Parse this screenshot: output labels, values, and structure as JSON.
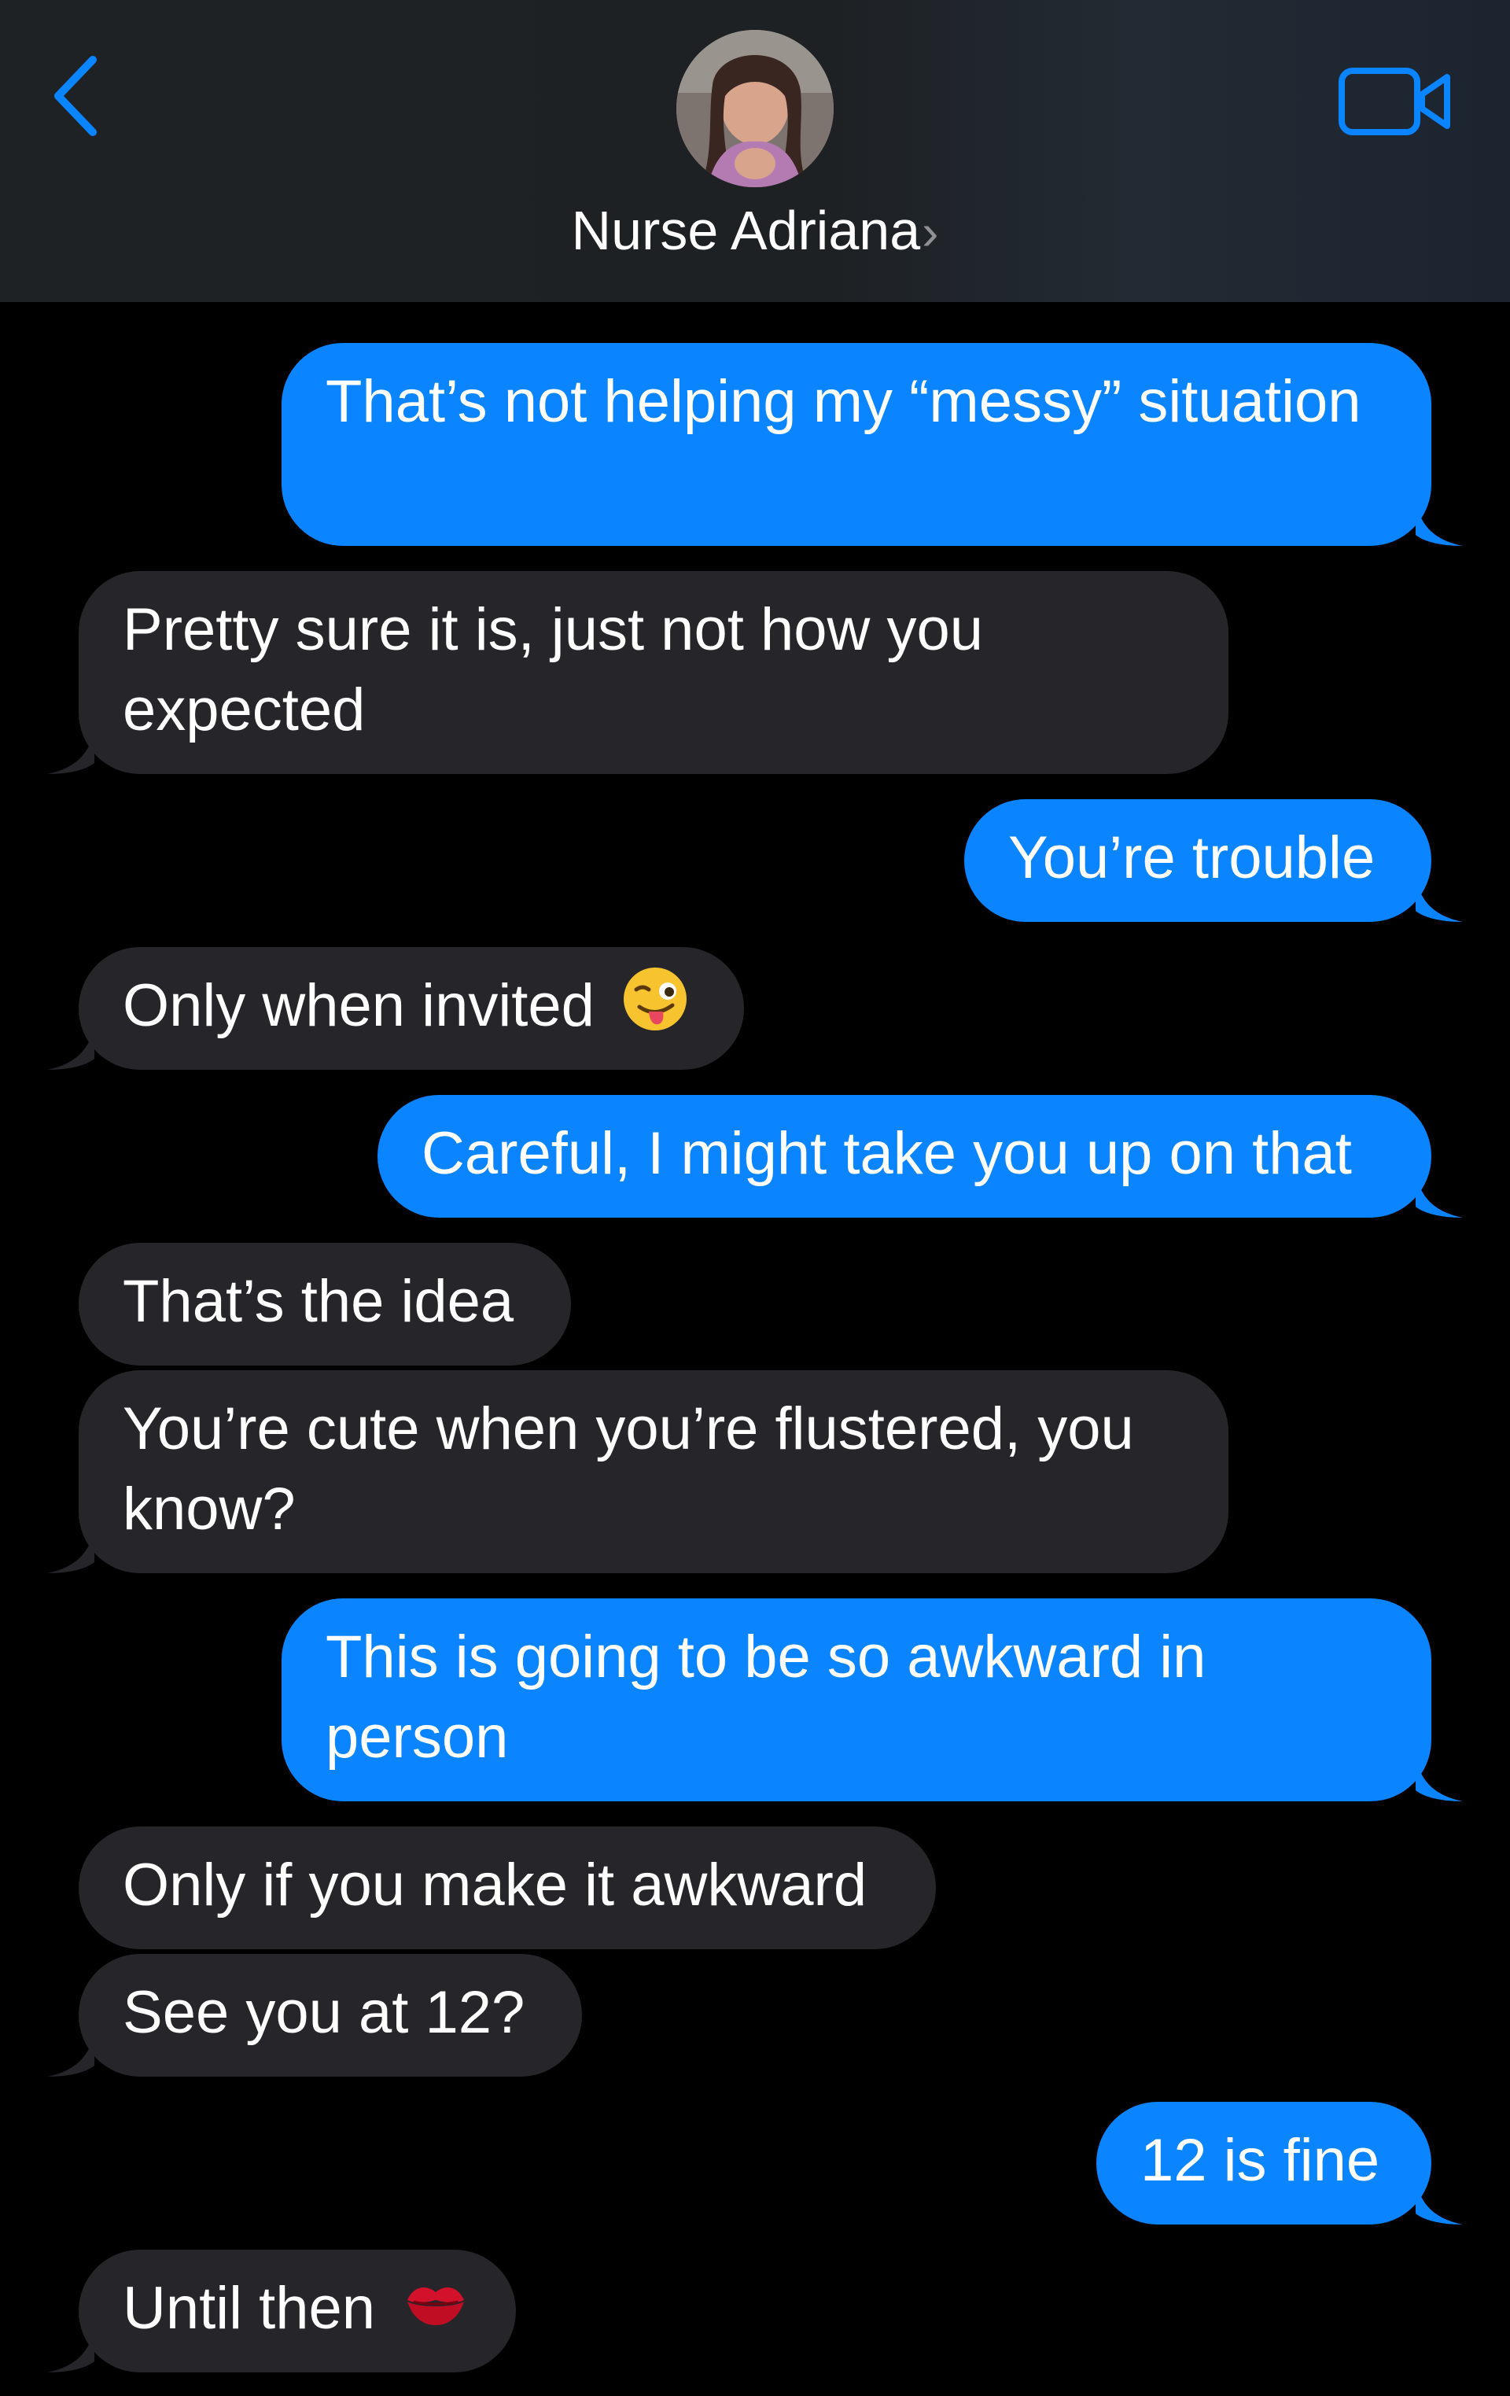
{
  "header": {
    "contact_name": "Nurse Adriana",
    "chevron": "›",
    "back_icon": "chevron-left-icon",
    "video_icon": "video-camera-icon",
    "accent_color": "#0a84ff"
  },
  "messages": [
    {
      "side": "sent",
      "text": "That’s not helping my “messy” situation"
    },
    {
      "side": "recv",
      "text": "Pretty sure it is, just not how you expected"
    },
    {
      "side": "sent",
      "text": "You’re trouble"
    },
    {
      "side": "recv",
      "text": "Only when invited",
      "emoji": "winking-tongue-emoji"
    },
    {
      "side": "sent",
      "text": "Careful, I might take you up on that"
    },
    {
      "side": "recv",
      "text": "That’s the idea"
    },
    {
      "side": "recv",
      "text": "You’re cute when you’re flustered, you know?"
    },
    {
      "side": "sent",
      "text": "This is going to be so awkward in person"
    },
    {
      "side": "recv",
      "text": "Only if you make it awkward"
    },
    {
      "side": "recv",
      "text": "See you at 12?"
    },
    {
      "side": "sent",
      "text": "12 is fine"
    },
    {
      "side": "recv",
      "text": "Until then",
      "emoji": "kiss-mark-emoji"
    }
  ]
}
